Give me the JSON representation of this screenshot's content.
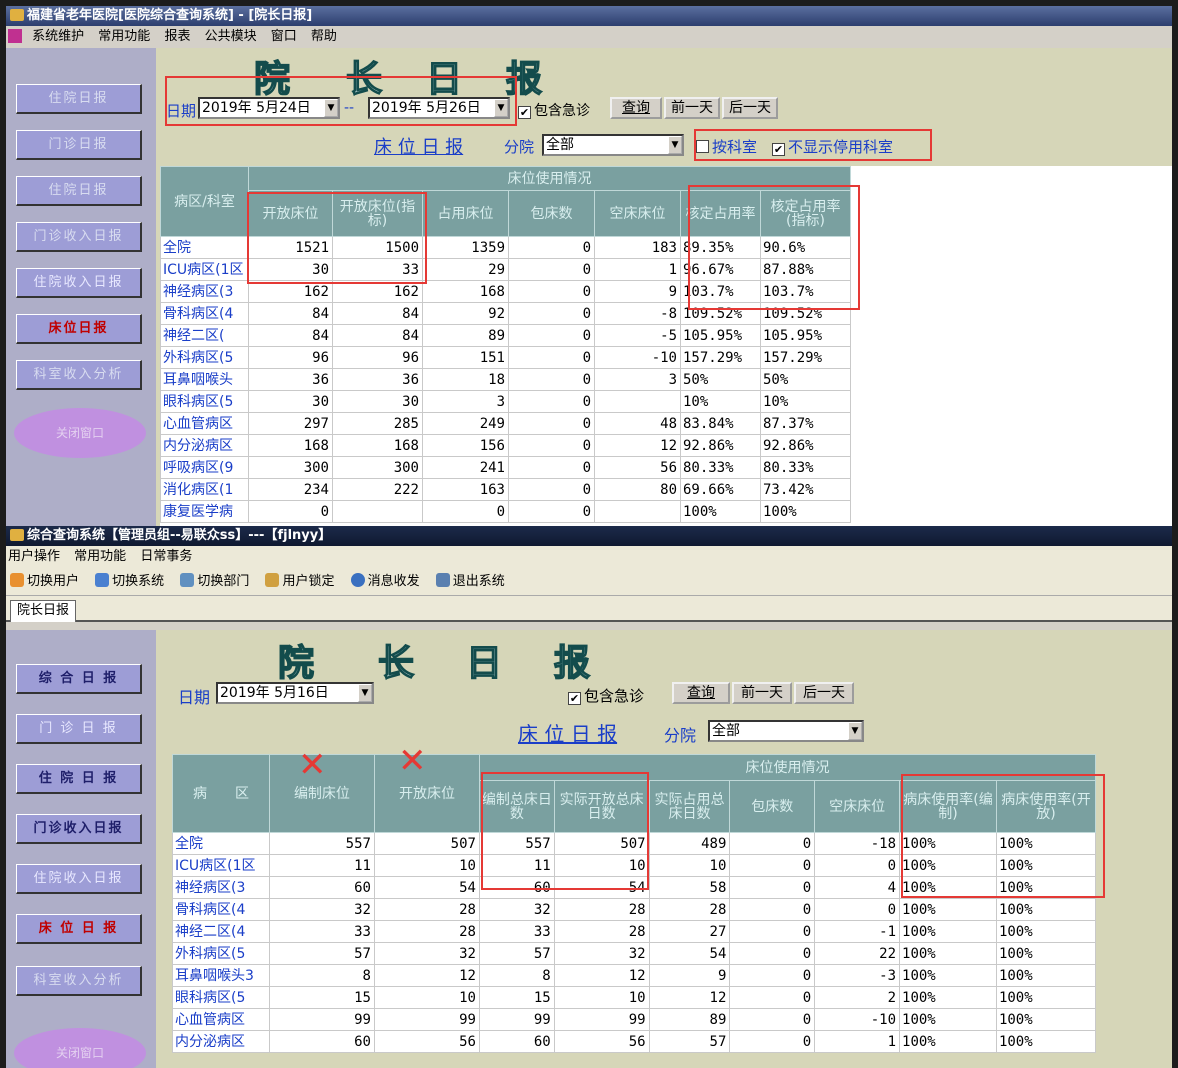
{
  "w1": {
    "title": "福建省老年医院[医院综合查询系统] - [院长日报]",
    "menus": [
      "系统维护",
      "常用功能",
      "报表",
      "公共模块",
      "窗口",
      "帮助"
    ],
    "sidebar": [
      "住院日报",
      "门诊日报",
      "住院日报",
      "门诊收入日报",
      "住院收入日报",
      "床位日报",
      "科室收入分析"
    ],
    "oval": "关闭窗口",
    "big_title": [
      "院",
      "长",
      "日",
      "报"
    ],
    "date_label": "日期",
    "date_from": "2019年 5月24日",
    "date_sep": "--",
    "date_to": "2019年 5月26日",
    "include_er": "包含急诊",
    "query": "查询",
    "prev": "前一天",
    "next": "后一天",
    "section": "床 位 日 报",
    "branch_label": "分院",
    "branch": "全部",
    "by_dept": "按科室",
    "hide_disabled": "不显示停用科室",
    "group_header": "床位使用情况",
    "columns": [
      "病区/科室",
      "开放床位",
      "开放床位(指标)",
      "占用床位",
      "包床数",
      "空床床位",
      "核定占用率",
      "核定占用率(指标)"
    ],
    "rows": [
      [
        "全院",
        "1521",
        "1500",
        "1359",
        "0",
        "183",
        "89.35%",
        "90.6%"
      ],
      [
        "ICU病区(1区",
        "30",
        "33",
        "29",
        "0",
        "1",
        "96.67%",
        "87.88%"
      ],
      [
        "神经病区(3",
        "162",
        "162",
        "168",
        "0",
        "9",
        "103.7%",
        "103.7%"
      ],
      [
        "骨科病区(4",
        "84",
        "84",
        "92",
        "0",
        "-8",
        "109.52%",
        "109.52%"
      ],
      [
        "神经二区(",
        "84",
        "84",
        "89",
        "0",
        "-5",
        "105.95%",
        "105.95%"
      ],
      [
        "外科病区(5",
        "96",
        "96",
        "151",
        "0",
        "-10",
        "157.29%",
        "157.29%"
      ],
      [
        "耳鼻咽喉头",
        "36",
        "36",
        "18",
        "0",
        "3",
        "50%",
        "50%"
      ],
      [
        "眼科病区(5",
        "30",
        "30",
        "3",
        "0",
        "",
        "10%",
        "10%"
      ],
      [
        "心血管病区",
        "297",
        "285",
        "249",
        "0",
        "48",
        "83.84%",
        "87.37%"
      ],
      [
        "内分泌病区",
        "168",
        "168",
        "156",
        "0",
        "12",
        "92.86%",
        "92.86%"
      ],
      [
        "呼吸病区(9",
        "300",
        "300",
        "241",
        "0",
        "56",
        "80.33%",
        "80.33%"
      ],
      [
        "消化病区(1",
        "234",
        "222",
        "163",
        "0",
        "80",
        "69.66%",
        "73.42%"
      ],
      [
        "康复医学病",
        "0",
        "",
        "0",
        "0",
        "",
        "100%",
        "100%"
      ]
    ]
  },
  "w2": {
    "title": "综合查询系统【管理员组--易联众ss】---【fjlnyy】",
    "menus": [
      "用户操作",
      "常用功能",
      "日常事务"
    ],
    "toolbar": [
      "切换用户",
      "切换系统",
      "切换部门",
      "用户锁定",
      "消息收发",
      "退出系统"
    ],
    "tab": "院长日报",
    "sidebar": [
      "综 合 日 报",
      "门 诊 日 报",
      "住 院 日 报",
      "门诊收入日报",
      "住院收入日报",
      "床 位 日 报",
      "科室收入分析"
    ],
    "oval": "关闭窗口",
    "big_title": [
      "院",
      "长",
      "日",
      "报"
    ],
    "date_label": "日期",
    "date": "2019年 5月16日",
    "include_er": "包含急诊",
    "query": "查询",
    "prev": "前一天",
    "next": "后一天",
    "section": "床 位 日 报",
    "branch_label": "分院",
    "branch": "全部",
    "group_header": "床位使用情况",
    "columns": [
      "病　　区",
      "编制床位",
      "开放床位",
      "编制总床日数",
      "实际开放总床日数",
      "实际占用总床日数",
      "包床数",
      "空床床位",
      "病床使用率(编制)",
      "病床使用率(开放)"
    ],
    "rows": [
      [
        "全院",
        "557",
        "507",
        "557",
        "507",
        "489",
        "0",
        "-18",
        "100%",
        "100%"
      ],
      [
        "ICU病区(1区",
        "11",
        "10",
        "11",
        "10",
        "10",
        "0",
        "0",
        "100%",
        "100%"
      ],
      [
        "神经病区(3",
        "60",
        "54",
        "60",
        "54",
        "58",
        "0",
        "4",
        "100%",
        "100%"
      ],
      [
        "骨科病区(4",
        "32",
        "28",
        "32",
        "28",
        "28",
        "0",
        "0",
        "100%",
        "100%"
      ],
      [
        "神经二区(4",
        "33",
        "28",
        "33",
        "28",
        "27",
        "0",
        "-1",
        "100%",
        "100%"
      ],
      [
        "外科病区(5",
        "57",
        "32",
        "57",
        "32",
        "54",
        "0",
        "22",
        "100%",
        "100%"
      ],
      [
        "耳鼻咽喉头3",
        "8",
        "12",
        "8",
        "12",
        "9",
        "0",
        "-3",
        "100%",
        "100%"
      ],
      [
        "眼科病区(5",
        "15",
        "10",
        "15",
        "10",
        "12",
        "0",
        "2",
        "100%",
        "100%"
      ],
      [
        "心血管病区",
        "99",
        "99",
        "99",
        "99",
        "89",
        "0",
        "-10",
        "100%",
        "100%"
      ],
      [
        "内分泌病区",
        "60",
        "56",
        "60",
        "56",
        "57",
        "0",
        "1",
        "100%",
        "100%"
      ]
    ]
  },
  "annotation": {
    "x_mark": "✕"
  }
}
